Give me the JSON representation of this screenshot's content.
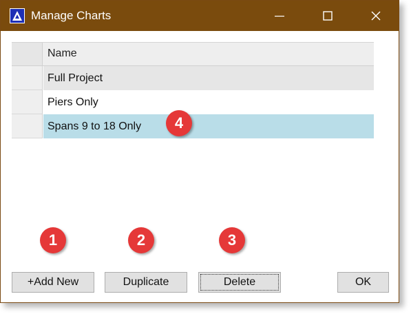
{
  "window": {
    "title": "Manage Charts",
    "titlebar_color": "#7a4b0d",
    "icon": "app-logo-icon"
  },
  "window_controls": {
    "minimize_icon": "minimize-icon",
    "maximize_icon": "maximize-icon",
    "close_icon": "close-icon"
  },
  "grid": {
    "columns": [
      "Name"
    ],
    "rows": [
      {
        "name": "Full Project"
      },
      {
        "name": "Piers Only"
      },
      {
        "name": "Spans 9 to 18 Only"
      }
    ],
    "selected_row_color": "#b9dde8"
  },
  "buttons": {
    "add_new": "+Add New",
    "duplicate": "Duplicate",
    "delete": "Delete",
    "ok": "OK"
  },
  "callouts": [
    "1",
    "2",
    "3",
    "4"
  ],
  "callout_color": "#e53838"
}
